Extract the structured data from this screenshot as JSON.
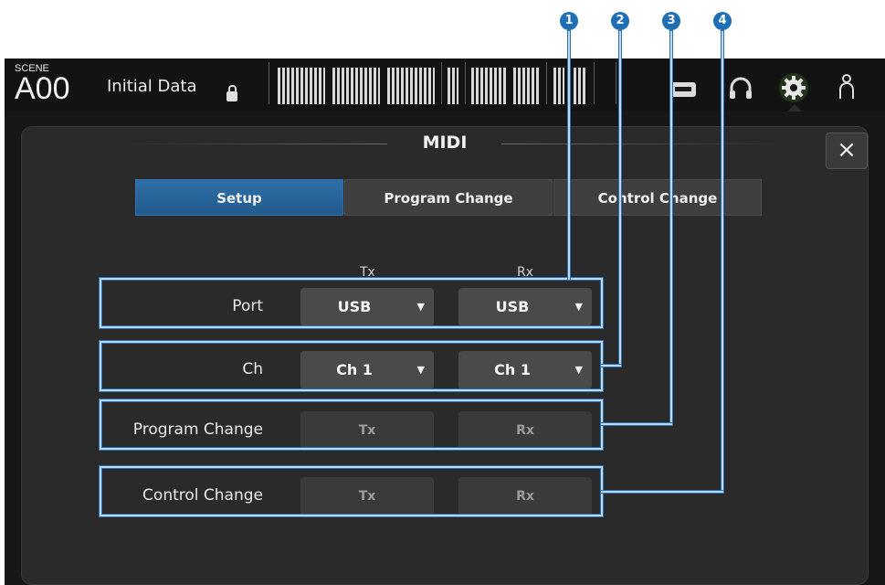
{
  "callouts": [
    "1",
    "2",
    "3",
    "4"
  ],
  "header": {
    "scene_label": "SCENE",
    "scene_number": "A00",
    "scene_name": "Initial Data",
    "icons": [
      "lock-icon",
      "meter-bridge",
      "recorder-icon",
      "headphones-icon",
      "gear-icon",
      "user-icon"
    ]
  },
  "dialog": {
    "title": "MIDI",
    "close_label": "×",
    "tabs": [
      {
        "label": "Setup",
        "active": true
      },
      {
        "label": "Program Change",
        "active": false
      },
      {
        "label": "Control Change",
        "active": false
      }
    ],
    "columns": {
      "tx": "Tx",
      "rx": "Rx"
    },
    "rows": {
      "port": {
        "label": "Port",
        "tx_value": "USB",
        "rx_value": "USB"
      },
      "ch": {
        "label": "Ch",
        "tx_value": "Ch 1",
        "rx_value": "Ch 1"
      },
      "program_change": {
        "label": "Program Change",
        "tx_label": "Tx",
        "rx_label": "Rx"
      },
      "control_change": {
        "label": "Control Change",
        "tx_label": "Tx",
        "rx_label": "Rx"
      }
    },
    "dropdown_arrow": "▼"
  },
  "colors": {
    "accent": "#2f6fa8",
    "callout": "#1f6fb5",
    "highlight": "#bcd9f5"
  }
}
